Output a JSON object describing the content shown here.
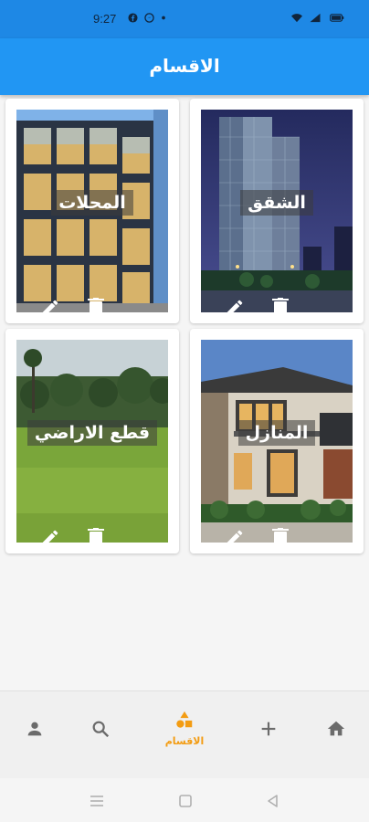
{
  "status_bar": {
    "time": "9:27",
    "icons": [
      "facebook-icon",
      "messenger-icon",
      "dot-icon",
      "wifi-icon",
      "signal-icon",
      "battery-icon"
    ]
  },
  "app_bar": {
    "title": "الاقسام",
    "color": "#2196f3"
  },
  "categories": [
    {
      "label": "الشقق",
      "image": "apartment-tower-photo"
    },
    {
      "label": "المحلات",
      "image": "glass-shop-building-photo"
    },
    {
      "label": "المنازل",
      "image": "modern-house-photo"
    },
    {
      "label": "قطع الاراضي",
      "image": "grass-land-photo"
    }
  ],
  "bottom_nav": {
    "active_color": "#f39c12",
    "items": [
      {
        "icon": "person-icon"
      },
      {
        "icon": "search-icon"
      },
      {
        "icon": "categories-icon",
        "label": "الاقسام",
        "active": true
      },
      {
        "icon": "add-icon"
      },
      {
        "icon": "home-icon"
      }
    ]
  },
  "system_nav": [
    "recents-icon",
    "home-square-icon",
    "back-icon"
  ]
}
